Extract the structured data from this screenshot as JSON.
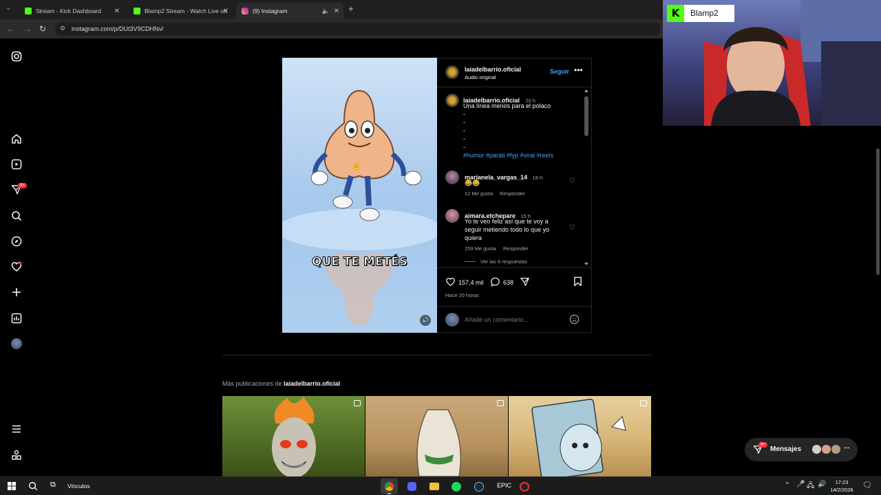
{
  "browser": {
    "tabs": [
      {
        "title": "Stream - Kick Dashboard",
        "color": "#53fc18"
      },
      {
        "title": "Blamp2 Stream - Watch Live on",
        "color": "#53fc18"
      },
      {
        "title": "(9) Instagram",
        "color": "#e1306c"
      }
    ],
    "new_tab_label": "+",
    "url": "instagram.com/p/DUt3V9CDHNv/"
  },
  "sidebar": {
    "notifications_badge": "9+"
  },
  "post": {
    "author": "laiadelbarrio.oficial",
    "audio": "Audio original",
    "follow_label": "Seguir",
    "caption_author": "laiadelbarrio.oficial",
    "caption_time": "20 h",
    "caption_text": "Una línea menos para el polaco",
    "caption_dashes": [
      "-",
      "-",
      "-",
      "-",
      "-"
    ],
    "hashtags": "#humor #parati #fyp #viral #reels",
    "overlay_text": "QUE TE METÉS",
    "comments": [
      {
        "user": "marianela_vargas_14",
        "time": "18 h",
        "text": "😂😂",
        "likes": "12 Me gusta",
        "reply": "Responder"
      },
      {
        "user": "aimara.etchepare",
        "time": "15 h",
        "text": "Yo te veo feliz así que te voy a seguir metiendo todo lo que yo quiera",
        "likes": "159 Me gusta",
        "reply": "Responder"
      }
    ],
    "view_replies": "Ver las 6 respuestas",
    "like_count": "157,4 mil",
    "comment_count": "638",
    "posted_ago": "Hace 20 horas",
    "add_comment_placeholder": "Añade un comentario..."
  },
  "more_posts": {
    "label": "Más publicaciones de",
    "author": "laiadelbarrio.oficial"
  },
  "messages": {
    "label": "Mensajes",
    "badge": "9+"
  },
  "webcam": {
    "channel": "Blamp2"
  },
  "taskbar": {
    "vinculos": "Vínculos",
    "time": "17:23",
    "date": "14/2/2026"
  }
}
